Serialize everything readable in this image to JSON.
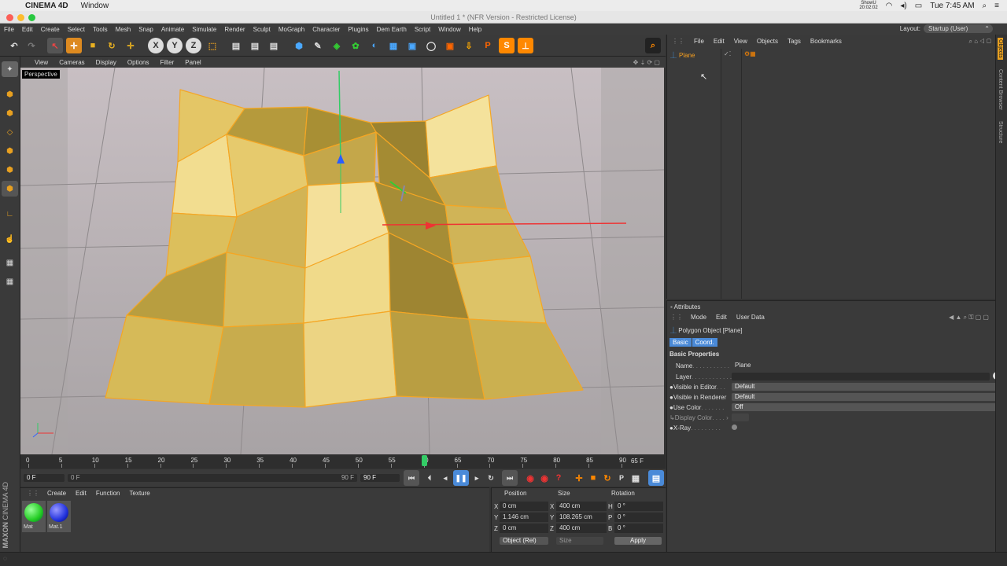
{
  "mac": {
    "app_name": "CINEMA 4D",
    "window_menu": "Window",
    "clock": "Tue 7:45 AM",
    "showu": "ShowU",
    "showu_time": "20:02:02"
  },
  "window_title": "Untitled 1 * (NFR Version - Restricted License)",
  "menu": [
    "File",
    "Edit",
    "Create",
    "Select",
    "Tools",
    "Mesh",
    "Snap",
    "Animate",
    "Simulate",
    "Render",
    "Sculpt",
    "MoGraph",
    "Character",
    "Plugins",
    "Dem Earth",
    "Script",
    "Window",
    "Help"
  ],
  "layout": {
    "label": "Layout:",
    "value": "Startup (User)"
  },
  "viewport": {
    "menu": [
      "View",
      "Cameras",
      "Display",
      "Options",
      "Filter",
      "Panel"
    ],
    "camera_label": "Perspective"
  },
  "timeline": {
    "ticks": [
      "0",
      "5",
      "10",
      "15",
      "20",
      "25",
      "30",
      "35",
      "40",
      "45",
      "50",
      "55",
      "60",
      "65",
      "70",
      "75",
      "80",
      "85",
      "90"
    ],
    "current_frame": "65 F",
    "playhead_fraction": 0.6667
  },
  "transport": {
    "start_field": "0 F",
    "slider_start": "0 F",
    "slider_end": "90 F",
    "end_field": "90 F"
  },
  "materials": {
    "menu": [
      "Create",
      "Edit",
      "Function",
      "Texture"
    ],
    "items": [
      {
        "name": "Mat",
        "color": "#22cc22"
      },
      {
        "name": "Mat.1",
        "color": "#2233dd"
      }
    ]
  },
  "coords": {
    "headers": [
      "Position",
      "Size",
      "Rotation"
    ],
    "rows": [
      {
        "axis": "X",
        "pos": "0 cm",
        "size_axis": "X",
        "size": "400 cm",
        "rot_axis": "H",
        "rot": "0 °"
      },
      {
        "axis": "Y",
        "pos": "1.146 cm",
        "size_axis": "Y",
        "size": "108.265 cm",
        "rot_axis": "P",
        "rot": "0 °"
      },
      {
        "axis": "Z",
        "pos": "0 cm",
        "size_axis": "Z",
        "size": "400 cm",
        "rot_axis": "B",
        "rot": "0 °"
      }
    ],
    "mode_select": "Object (Rel)",
    "size_select": "Size",
    "apply": "Apply"
  },
  "objects": {
    "menu": [
      "File",
      "Edit",
      "View",
      "Objects",
      "Tags",
      "Bookmarks"
    ],
    "tree": [
      {
        "name": "Plane"
      }
    ]
  },
  "attributes": {
    "title": "Attributes",
    "menu": [
      "Mode",
      "Edit",
      "User Data"
    ],
    "object_title": "Polygon Object [Plane]",
    "tabs": [
      "Basic",
      "Coord."
    ],
    "section": "Basic Properties",
    "fields": [
      {
        "label": "Name",
        "value": "Plane"
      },
      {
        "label": "Layer",
        "value": ""
      },
      {
        "label": "Visible in Editor",
        "value": "Default"
      },
      {
        "label": "Visible in Renderer",
        "value": "Default"
      },
      {
        "label": "Use Color",
        "value": "Off"
      },
      {
        "label": "Display Color",
        "value": ""
      },
      {
        "label": "X-Ray",
        "value": ""
      }
    ]
  },
  "side_tabs": [
    "Objects",
    "Content Browser",
    "Structure"
  ],
  "brand": [
    "MAXON",
    "CINEMA 4D"
  ],
  "colors": {
    "mesh_fill": "#d9b84a",
    "mesh_edge": "#ffa500",
    "accent": "#f0a020"
  }
}
